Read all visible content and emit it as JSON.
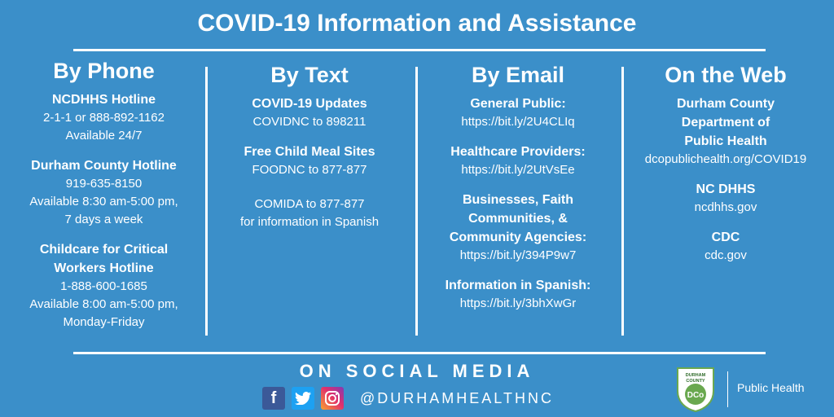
{
  "title": "COVID-19 Information and Assistance",
  "columns": [
    {
      "heading": "By Phone",
      "entries": [
        {
          "head": "NCDHHS Hotline",
          "lines": [
            "2-1-1 or 888-892-1162",
            "Available 24/7"
          ]
        },
        {
          "head": "Durham County Hotline",
          "lines": [
            "919-635-8150",
            "Available 8:30 am-5:00 pm,",
            "7 days a week"
          ]
        },
        {
          "head": "Childcare for Critical",
          "head2": "Workers Hotline",
          "lines": [
            "1-888-600-1685",
            "Available 8:00 am-5:00 pm,",
            "Monday-Friday"
          ]
        }
      ]
    },
    {
      "heading": "By Text",
      "entries": [
        {
          "head": "COVID-19 Updates",
          "lines": [
            "COVIDNC to 898211"
          ]
        },
        {
          "head": "Free Child Meal Sites",
          "lines": [
            "FOODNC to 877-877"
          ]
        },
        {
          "lines": [
            "COMIDA to 877-877",
            "for information in Spanish"
          ]
        }
      ]
    },
    {
      "heading": "By Email",
      "entries": [
        {
          "head": "General Public:",
          "lines": [
            "https://bit.ly/2U4CLIq"
          ]
        },
        {
          "head": "Healthcare Providers:",
          "lines": [
            "https://bit.ly/2UtVsEe"
          ]
        },
        {
          "head": "Businesses, Faith",
          "head2": "Communities, &",
          "head3": "Community Agencies:",
          "lines": [
            "https://bit.ly/394P9w7"
          ]
        },
        {
          "head": "Information in Spanish:",
          "lines": [
            "https://bit.ly/3bhXwGr"
          ]
        }
      ]
    },
    {
      "heading": "On the Web",
      "entries": [
        {
          "head": "Durham County",
          "head2": "Department of",
          "head3": "Public Health",
          "lines": [
            "dcopublichealth.org/COVID19"
          ]
        },
        {
          "head": "NC DHHS",
          "lines": [
            "ncdhhs.gov"
          ]
        },
        {
          "head": "CDC",
          "lines": [
            "cdc.gov"
          ]
        }
      ]
    }
  ],
  "social": {
    "title": "ON SOCIAL MEDIA",
    "handle": "@DURHAMHEALTHNC",
    "icons": [
      "facebook-icon",
      "twitter-icon",
      "instagram-icon"
    ]
  },
  "logo": {
    "seal_text": "DURHAM COUNTY",
    "seal_mark": "DCo",
    "seal_year": "1881",
    "label": "Public Health",
    "seal_color": "#6aa84f"
  }
}
